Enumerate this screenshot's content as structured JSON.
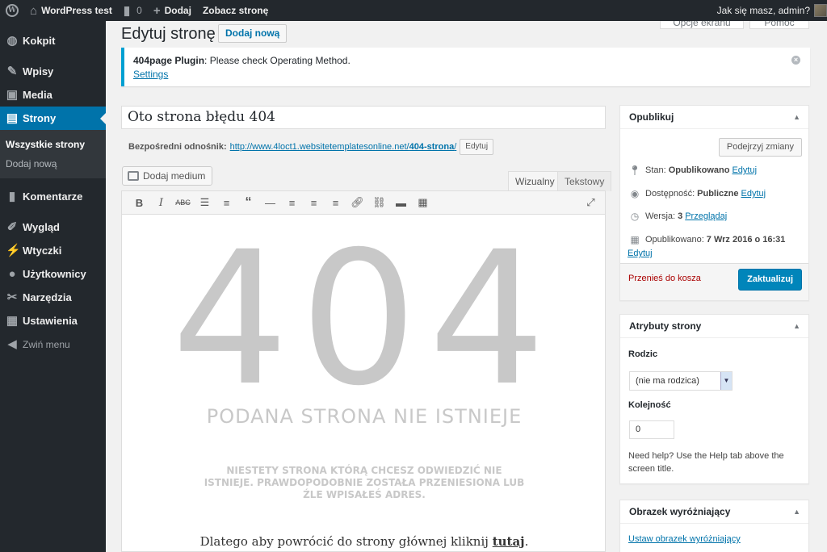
{
  "adminbar": {
    "site_name": "WordPress test",
    "comments_count": "0",
    "new_label": "Dodaj",
    "view_page": "Zobacz stronę",
    "greeting": "Jak się masz, admin?"
  },
  "menu": {
    "items": [
      {
        "label": "Kokpit",
        "icon": "dashboard-icon"
      },
      {
        "label": "Wpisy",
        "icon": "pin-icon"
      },
      {
        "label": "Media",
        "icon": "media-icon"
      },
      {
        "label": "Strony",
        "icon": "pages-icon"
      },
      {
        "label": "Komentarze",
        "icon": "comments-icon"
      },
      {
        "label": "Wygląd",
        "icon": "appearance-icon"
      },
      {
        "label": "Wtyczki",
        "icon": "plugins-icon"
      },
      {
        "label": "Użytkownicy",
        "icon": "users-icon"
      },
      {
        "label": "Narzędzia",
        "icon": "tools-icon"
      },
      {
        "label": "Ustawienia",
        "icon": "settings-icon"
      }
    ],
    "sub": [
      "Wszystkie strony",
      "Dodaj nową"
    ],
    "collapse": "Zwiń menu"
  },
  "screen_tabs": [
    "Opcje ekranu",
    "Pomoc"
  ],
  "header": {
    "title": "Edytuj stronę",
    "add_new": "Dodaj nową"
  },
  "notice": {
    "plugin": "404page Plugin",
    "message": ": Please check Operating Method.",
    "link": "Settings"
  },
  "post": {
    "title": "Oto strona błędu 404",
    "permalink_label": "Bezpośredni odnośnik:",
    "permalink_base": "http://www.4loct1.websitetemplatesonline.net/",
    "permalink_slug": "404-strona",
    "permalink_end": "/",
    "permalink_edit": "Edytuj"
  },
  "editor": {
    "add_media": "Dodaj medium",
    "tab_visual": "Wizualny",
    "tab_text": "Tekstowy",
    "big": "404",
    "heading": "PODANA STRONA NIE ISTNIEJE",
    "desc": "NIESTETY STRONA KTÓRĄ CHCESZ ODWIEDZIĆ NIE ISTNIEJE. PRAWDOPODOBNIE ZOSTAŁA PRZENIESIONA LUB ŹLE WPISAŁEŚ ADRES.",
    "back_text": "Dlatego aby powrócić do strony głównej kliknij ",
    "back_link": "tutaj",
    "back_end": "."
  },
  "publish": {
    "title": "Opublikuj",
    "preview": "Podejrzyj zmiany",
    "status_label": "Stan:",
    "status_value": "Opublikowano",
    "visibility_label": "Dostępność:",
    "visibility_value": "Publiczne",
    "revisions_label": "Wersja:",
    "revisions_value": "3",
    "revisions_link": "Przeglądaj",
    "published_label": "Opublikowano:",
    "published_value": "7 Wrz 2016 o 16:31",
    "edit": "Edytuj",
    "trash": "Przenieś do kosza",
    "update": "Zaktualizuj"
  },
  "attributes": {
    "title": "Atrybuty strony",
    "parent_label": "Rodzic",
    "parent_value": "(nie ma rodzica)",
    "order_label": "Kolejność",
    "order_value": "0",
    "help": "Need help? Use the Help tab above the screen title."
  },
  "featured": {
    "title": "Obrazek wyróżniający",
    "link": "Ustaw obrazek wyróżniający"
  }
}
